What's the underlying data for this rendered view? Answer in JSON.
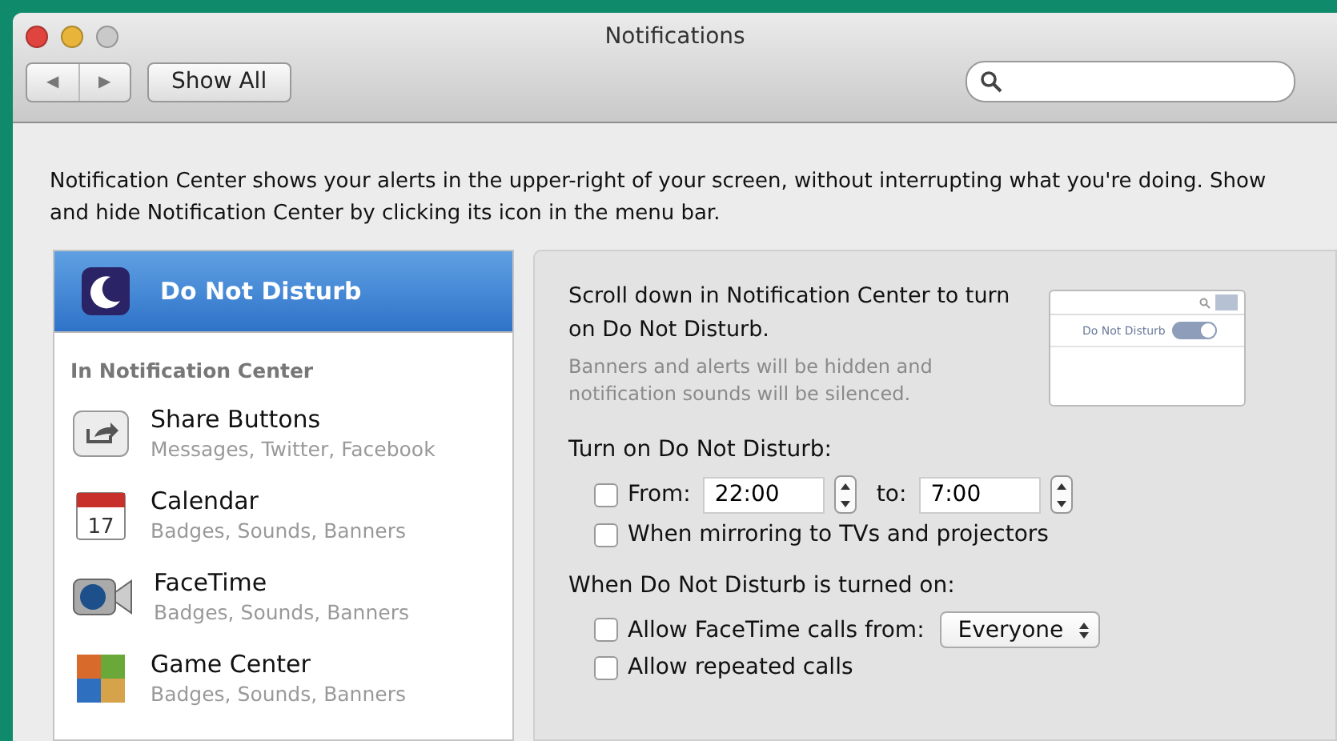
{
  "window": {
    "title": "Notifications"
  },
  "toolbar": {
    "back": "◀",
    "forward": "▶",
    "show_all": "Show All"
  },
  "description": "Notification Center shows your alerts in the upper-right of your screen, without interrupting what you're doing. Show and hide Notification Center by clicking its icon in the menu bar.",
  "sidebar": {
    "top_item": {
      "label": "Do Not Disturb",
      "selected": true
    },
    "section": "In Notification Center",
    "items": [
      {
        "kind": "share",
        "name": "Share Buttons",
        "detail": "Messages, Twitter, Facebook",
        "selected": false
      },
      {
        "kind": "calendar",
        "icon_text": "17",
        "name": "Calendar",
        "detail": "Badges, Sounds, Banners",
        "selected": false
      },
      {
        "kind": "facetime",
        "name": "FaceTime",
        "detail": "Badges, Sounds, Banners",
        "selected": false
      },
      {
        "kind": "gamecenter",
        "name": "Game Center",
        "detail": "Badges, Sounds, Banners",
        "selected": false
      }
    ]
  },
  "panel": {
    "intro": "Scroll down in Notification Center to turn on Do Not Disturb.",
    "note": "Banners and alerts will be hidden and notification sounds will be silenced.",
    "preview": {
      "label": "Do Not Disturb",
      "on": true
    },
    "schedule_heading": "Turn on Do Not Disturb:",
    "from": {
      "label": "From:",
      "checked": false,
      "start": "22:00",
      "to_label": "to:",
      "end": "7:00"
    },
    "mirroring": {
      "label": "When mirroring to TVs and projectors",
      "checked": false
    },
    "when_on_heading": "When Do Not Disturb is turned on:",
    "facetime": {
      "label": "Allow FaceTime calls from:",
      "checked": false,
      "choice": "Everyone"
    },
    "repeated": {
      "label": "Allow repeated calls",
      "checked": false
    }
  }
}
